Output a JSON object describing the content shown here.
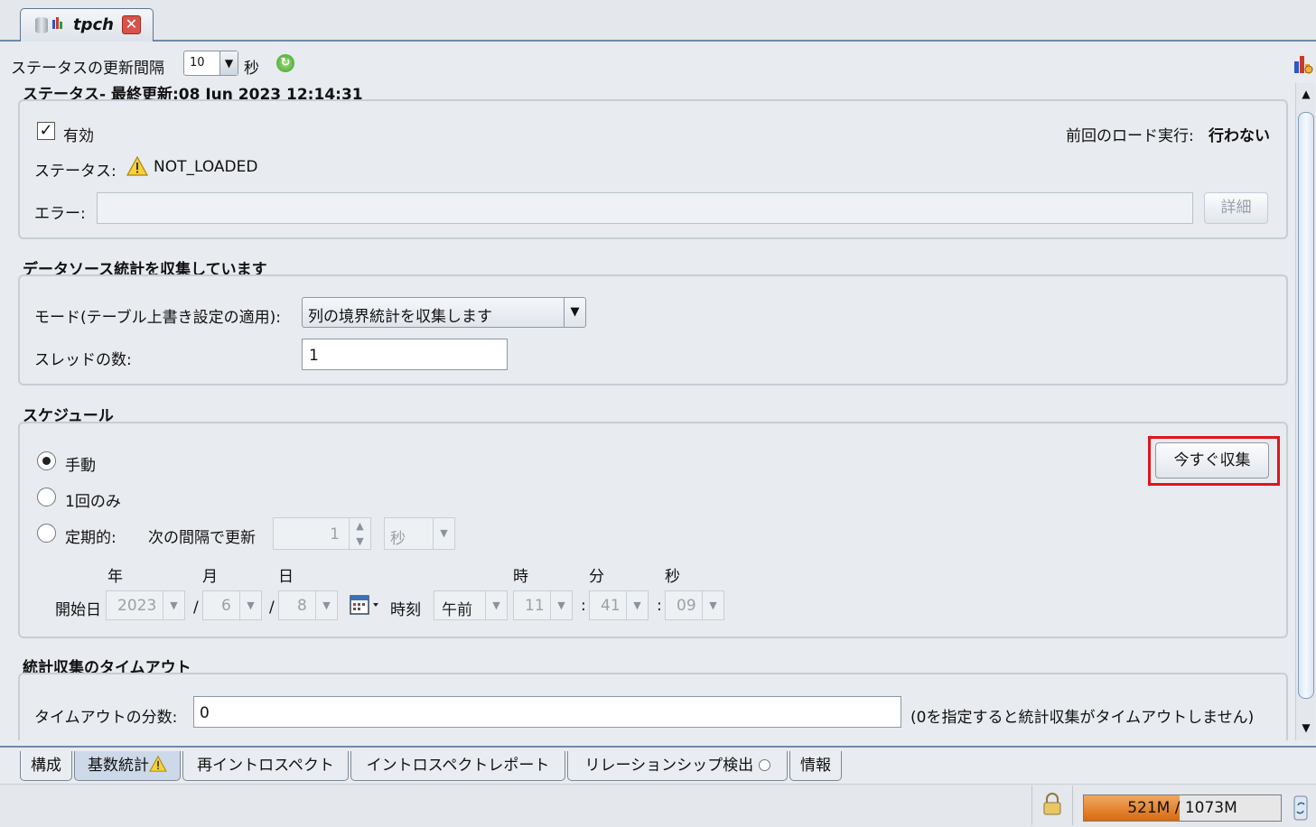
{
  "tab": {
    "title": "tpch",
    "close": "✕"
  },
  "refresh": {
    "label": "ステータスの更新間隔",
    "value": "10",
    "unit": "秒"
  },
  "status_section": {
    "title": "ステータス- 最終更新:08 Jun 2023 12:14:31",
    "enabled_label": "有効",
    "enabled": true,
    "last_load_label": "前回のロード実行:",
    "last_load_value": "行わない",
    "status_label": "ステータス:",
    "status_value": "NOT_LOADED",
    "error_label": "エラー:",
    "error_value": "",
    "details_button": "詳細"
  },
  "collect_section": {
    "title": "データソース統計を収集しています",
    "mode_label": "モード(テーブル上書き設定の適用):",
    "mode_value": "列の境界統計を収集します",
    "threads_label": "スレッドの数:",
    "threads_value": "1"
  },
  "schedule_section": {
    "title": "スケジュール",
    "manual_label": "手動",
    "once_label": "1回のみ",
    "periodic_label": "定期的:",
    "interval_label": "次の間隔で更新",
    "interval_value": "1",
    "interval_unit": "秒",
    "collect_now_button": "今すぐ収集",
    "col_year": "年",
    "col_month": "月",
    "col_day": "日",
    "col_hour": "時",
    "col_minute": "分",
    "col_second": "秒",
    "start_date_label": "開始日",
    "year": "2023",
    "month": "6",
    "day": "8",
    "sep_slash": "/",
    "sep_colon": ":",
    "time_label": "時刻",
    "ampm": "午前",
    "hour": "11",
    "minute": "41",
    "second": "09"
  },
  "timeout_section": {
    "title": "統計収集のタイムアウト",
    "minutes_label": "タイムアウトの分数:",
    "minutes_value": "0",
    "note": "(0を指定すると統計収集がタイムアウトしません)"
  },
  "bottom_tabs": [
    "構成",
    "基数統計",
    "再イントロスペクト",
    "イントロスペクトレポート",
    "リレーションシップ検出",
    "情報"
  ],
  "memory": {
    "text": "521M / 1073M",
    "used_mb": 521,
    "total_mb": 1073
  },
  "colors": {
    "highlight": "#e0141c",
    "memory_fill": "#d86a10",
    "accent": "#6f8aa8"
  }
}
